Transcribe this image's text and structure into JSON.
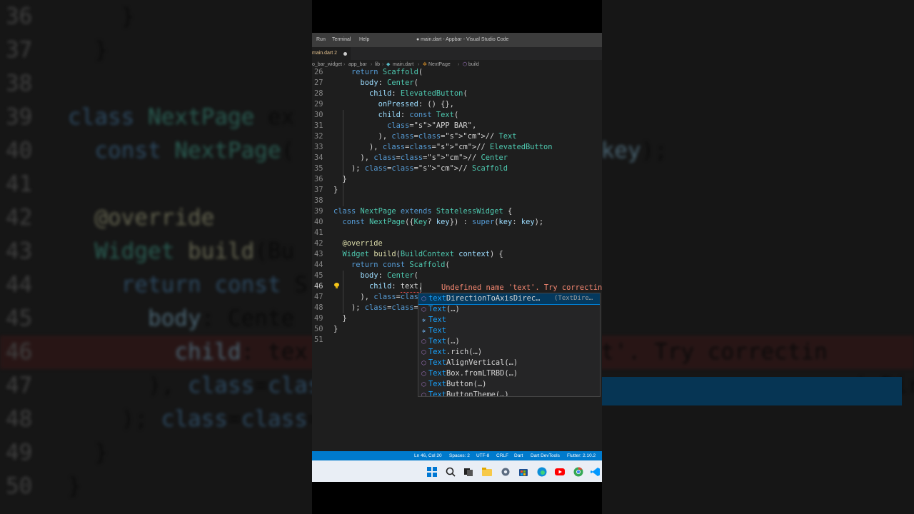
{
  "window": {
    "menu": [
      "Run",
      "Terminal",
      "Help"
    ],
    "title": "● main.dart - Appbar - Visual Studio Code"
  },
  "tab": {
    "label": "main.dart 2"
  },
  "breadcrumb": [
    "o_bar_widget",
    "app_bar",
    "lib",
    "main.dart",
    "NextPage",
    "build"
  ],
  "editor": {
    "current_line": 46,
    "inline_error": "Undefined name 'text'. Try correctin",
    "lines": [
      {
        "n": "26",
        "code": "    return Scaffold("
      },
      {
        "n": "27",
        "code": "      body: Center("
      },
      {
        "n": "28",
        "code": "        child: ElevatedButton("
      },
      {
        "n": "29",
        "code": "          onPressed: () {},"
      },
      {
        "n": "30",
        "code": "          child: const Text("
      },
      {
        "n": "31",
        "code": "            \"APP BAR\","
      },
      {
        "n": "32",
        "code": "          ), // Text"
      },
      {
        "n": "33",
        "code": "        ), // ElevatedButton"
      },
      {
        "n": "34",
        "code": "      ), // Center"
      },
      {
        "n": "35",
        "code": "    ); // Scaffold"
      },
      {
        "n": "36",
        "code": "  }"
      },
      {
        "n": "37",
        "code": "}"
      },
      {
        "n": "38",
        "code": ""
      },
      {
        "n": "39",
        "code": "class NextPage extends StatelessWidget {"
      },
      {
        "n": "40",
        "code": "  const NextPage({Key? key}) : super(key: key);"
      },
      {
        "n": "41",
        "code": ""
      },
      {
        "n": "42",
        "code": "  @override"
      },
      {
        "n": "43",
        "code": "  Widget build(BuildContext context) {"
      },
      {
        "n": "44",
        "code": "    return const Scaffold("
      },
      {
        "n": "45",
        "code": "      body: Center("
      },
      {
        "n": "46",
        "code": "        child: text,"
      },
      {
        "n": "47",
        "code": "      ), // Center"
      },
      {
        "n": "48",
        "code": "    ); // Scaffold"
      },
      {
        "n": "49",
        "code": "  }"
      },
      {
        "n": "50",
        "code": "}"
      },
      {
        "n": "51",
        "code": ""
      }
    ]
  },
  "suggestions": [
    {
      "match": "text",
      "rest": "DirectionToAxisDirec…",
      "detail": "(TextDire…",
      "kind": "method",
      "selected": true
    },
    {
      "match": "Text",
      "rest": "(…)",
      "detail": "",
      "kind": "method"
    },
    {
      "match": "Text",
      "rest": "",
      "detail": "",
      "kind": "class"
    },
    {
      "match": "Text",
      "rest": "",
      "detail": "",
      "kind": "class"
    },
    {
      "match": "Text",
      "rest": "(…)",
      "detail": "",
      "kind": "method"
    },
    {
      "match": "Text",
      "rest": ".rich(…)",
      "detail": "",
      "kind": "method"
    },
    {
      "match": "Text",
      "rest": "AlignVertical(…)",
      "detail": "",
      "kind": "method"
    },
    {
      "match": "Text",
      "rest": "Box.fromLTRBD(…)",
      "detail": "",
      "kind": "method"
    },
    {
      "match": "Text",
      "rest": "Button(…)",
      "detail": "",
      "kind": "method"
    },
    {
      "match": "Text",
      "rest": "ButtonTheme(…)",
      "detail": "",
      "kind": "method"
    }
  ],
  "statusbar": {
    "position": "Ln 46, Col 20",
    "spaces": "Spaces: 2",
    "encoding": "UTF-8",
    "eol": "CRLF",
    "language": "Dart",
    "devtools": "Dart DevTools",
    "flutter": "Flutter: 2.10.2"
  },
  "background": {
    "lines": [
      {
        "n": "36",
        "code": "    }"
      },
      {
        "n": "37",
        "code": "  }"
      },
      {
        "n": "38",
        "code": ""
      },
      {
        "n": "39",
        "code": "class NextPage ex                    {"
      },
      {
        "n": "40",
        "code": "  const NextPage(                  key: key);"
      },
      {
        "n": "41",
        "code": ""
      },
      {
        "n": "42",
        "code": "  @override"
      },
      {
        "n": "43",
        "code": "  Widget build(Bu"
      },
      {
        "n": "44",
        "code": "    return const S"
      },
      {
        "n": "45",
        "code": "      body: Cente"
      },
      {
        "n": "46",
        "code": "        child: tex                e 'text'. Try correctin"
      },
      {
        "n": "47",
        "code": "      ), // Cente                     isDirec…     (TextDire…"
      },
      {
        "n": "48",
        "code": "    ); // Scaffol"
      },
      {
        "n": "49",
        "code": "  }"
      },
      {
        "n": "50",
        "code": "}"
      }
    ]
  },
  "colors": {
    "statusbar": "#007acc",
    "editor_bg": "#1e1e1e",
    "selection": "#04395e"
  },
  "taskbar_icons": [
    "windows-start-icon",
    "search-icon",
    "task-view-icon",
    "file-explorer-icon",
    "settings-icon",
    "store-icon",
    "edge-icon",
    "youtube-icon",
    "chrome-icon",
    "vscode-icon"
  ]
}
